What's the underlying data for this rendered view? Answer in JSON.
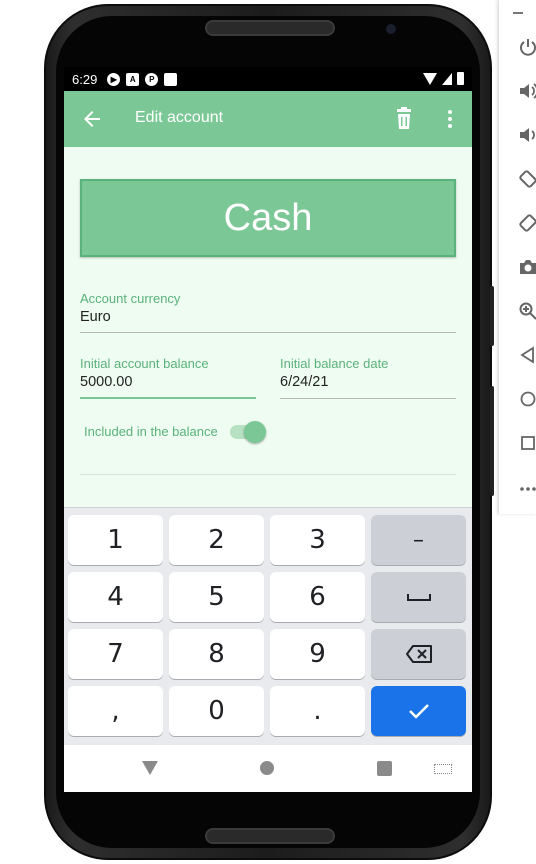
{
  "status_bar": {
    "time": "6:29",
    "left_icons": [
      "play-icon",
      "a-icon",
      "p-icon",
      "sd-card-icon"
    ],
    "right_icons": [
      "wifi-icon",
      "cellular-icon",
      "battery-icon"
    ]
  },
  "app_bar": {
    "title": "Edit account",
    "back_icon": "arrow-left-icon",
    "delete_icon": "trash-icon",
    "menu_icon": "more-vert-icon"
  },
  "account_name": "Cash",
  "account_currency": {
    "label": "Account currency",
    "value": "Euro"
  },
  "initial_balance": {
    "label": "Initial account balance",
    "value": "5000.00"
  },
  "initial_date": {
    "label": "Initial balance date",
    "value": "6/24/21"
  },
  "included_in_balance": {
    "label": "Included in the balance",
    "checked": true
  },
  "keyboard": {
    "keys": [
      "1",
      "2",
      "3",
      "–",
      "4",
      "5",
      "6",
      "␣",
      "7",
      "8",
      "9",
      "⌫",
      ",",
      "0",
      ".",
      "✓"
    ]
  },
  "nav_bar": [
    "back-nav-icon",
    "home-nav-icon",
    "recents-nav-icon",
    "keyboard-switch-icon"
  ],
  "emulator_toolbar": [
    "power-icon",
    "volume-up-icon",
    "volume-down-icon",
    "rotate-left-icon",
    "rotate-right-icon",
    "camera-icon",
    "zoom-icon",
    "back-icon",
    "home-icon",
    "overview-icon",
    "more-icon"
  ],
  "colors": {
    "primary": "#7bc896",
    "background": "#eefcf1",
    "label": "#5ab27a",
    "enter_key": "#1a73e8"
  }
}
